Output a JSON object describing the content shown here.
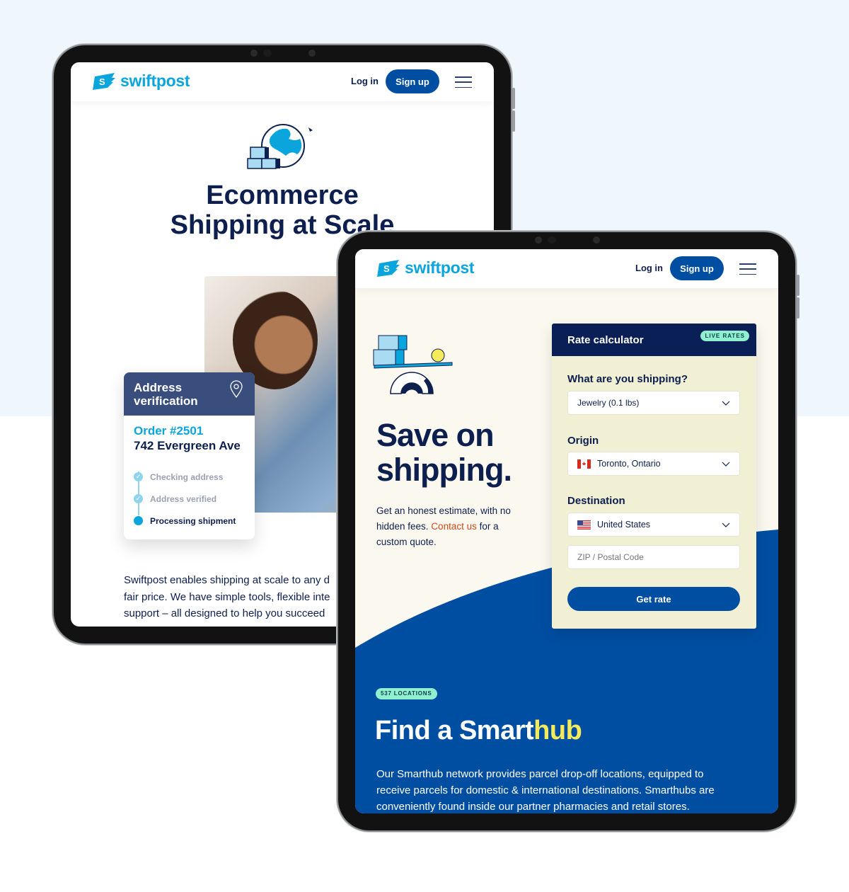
{
  "brand": {
    "name": "swiftpost",
    "logo_letter": "S"
  },
  "nav": {
    "login": "Log in",
    "signup": "Sign up"
  },
  "colors": {
    "accent": "#004ea2",
    "navy": "#0d1f4f",
    "cyan": "#0aa5dc",
    "mint": "#8ff0d0",
    "yellow": "#f5ea5a",
    "link": "#d4481a"
  },
  "tablet1": {
    "hero_title_1": "Ecommerce",
    "hero_title_2": "Shipping at Scale",
    "card": {
      "title_1": "Address",
      "title_2": "verification",
      "order": "Order #2501",
      "address": "742 Evergreen Ave",
      "steps": [
        {
          "label": "Checking address",
          "status": "done"
        },
        {
          "label": "Address verified",
          "status": "done"
        },
        {
          "label": "Processing shipment",
          "status": "active"
        }
      ]
    },
    "body_lines": [
      "Swiftpost enables shipping at scale to any d",
      "fair price. We have simple tools, flexible inte",
      "support – all designed to help you succeed"
    ]
  },
  "tablet2": {
    "hero_title_1": "Save on",
    "hero_title_2": "shipping.",
    "desc_pre": "Get an honest estimate, with no hidden fees. ",
    "desc_link": "Contact us",
    "desc_post": " for a custom quote.",
    "rate": {
      "title": "Rate calculator",
      "badge": "LIVE RATES",
      "shipping_label": "What are you shipping?",
      "shipping_value": "Jewelry (0.1 lbs)",
      "origin_label": "Origin",
      "origin_value": "Toronto, Ontario",
      "origin_flag": "flag-canada",
      "dest_label": "Destination",
      "dest_value": "United States",
      "dest_flag": "flag-usa",
      "zip_placeholder": "ZIP / Postal Code",
      "button": "Get rate"
    },
    "smarthub": {
      "badge": "537 LOCATIONS",
      "title_pre": "Find a Smart",
      "title_hl": "hub",
      "body": "Our Smarthub network provides parcel drop-off locations, equipped to receive parcels for domestic & international destinations. Smarthubs are conveniently found inside our partner pharmacies and retail stores."
    }
  }
}
